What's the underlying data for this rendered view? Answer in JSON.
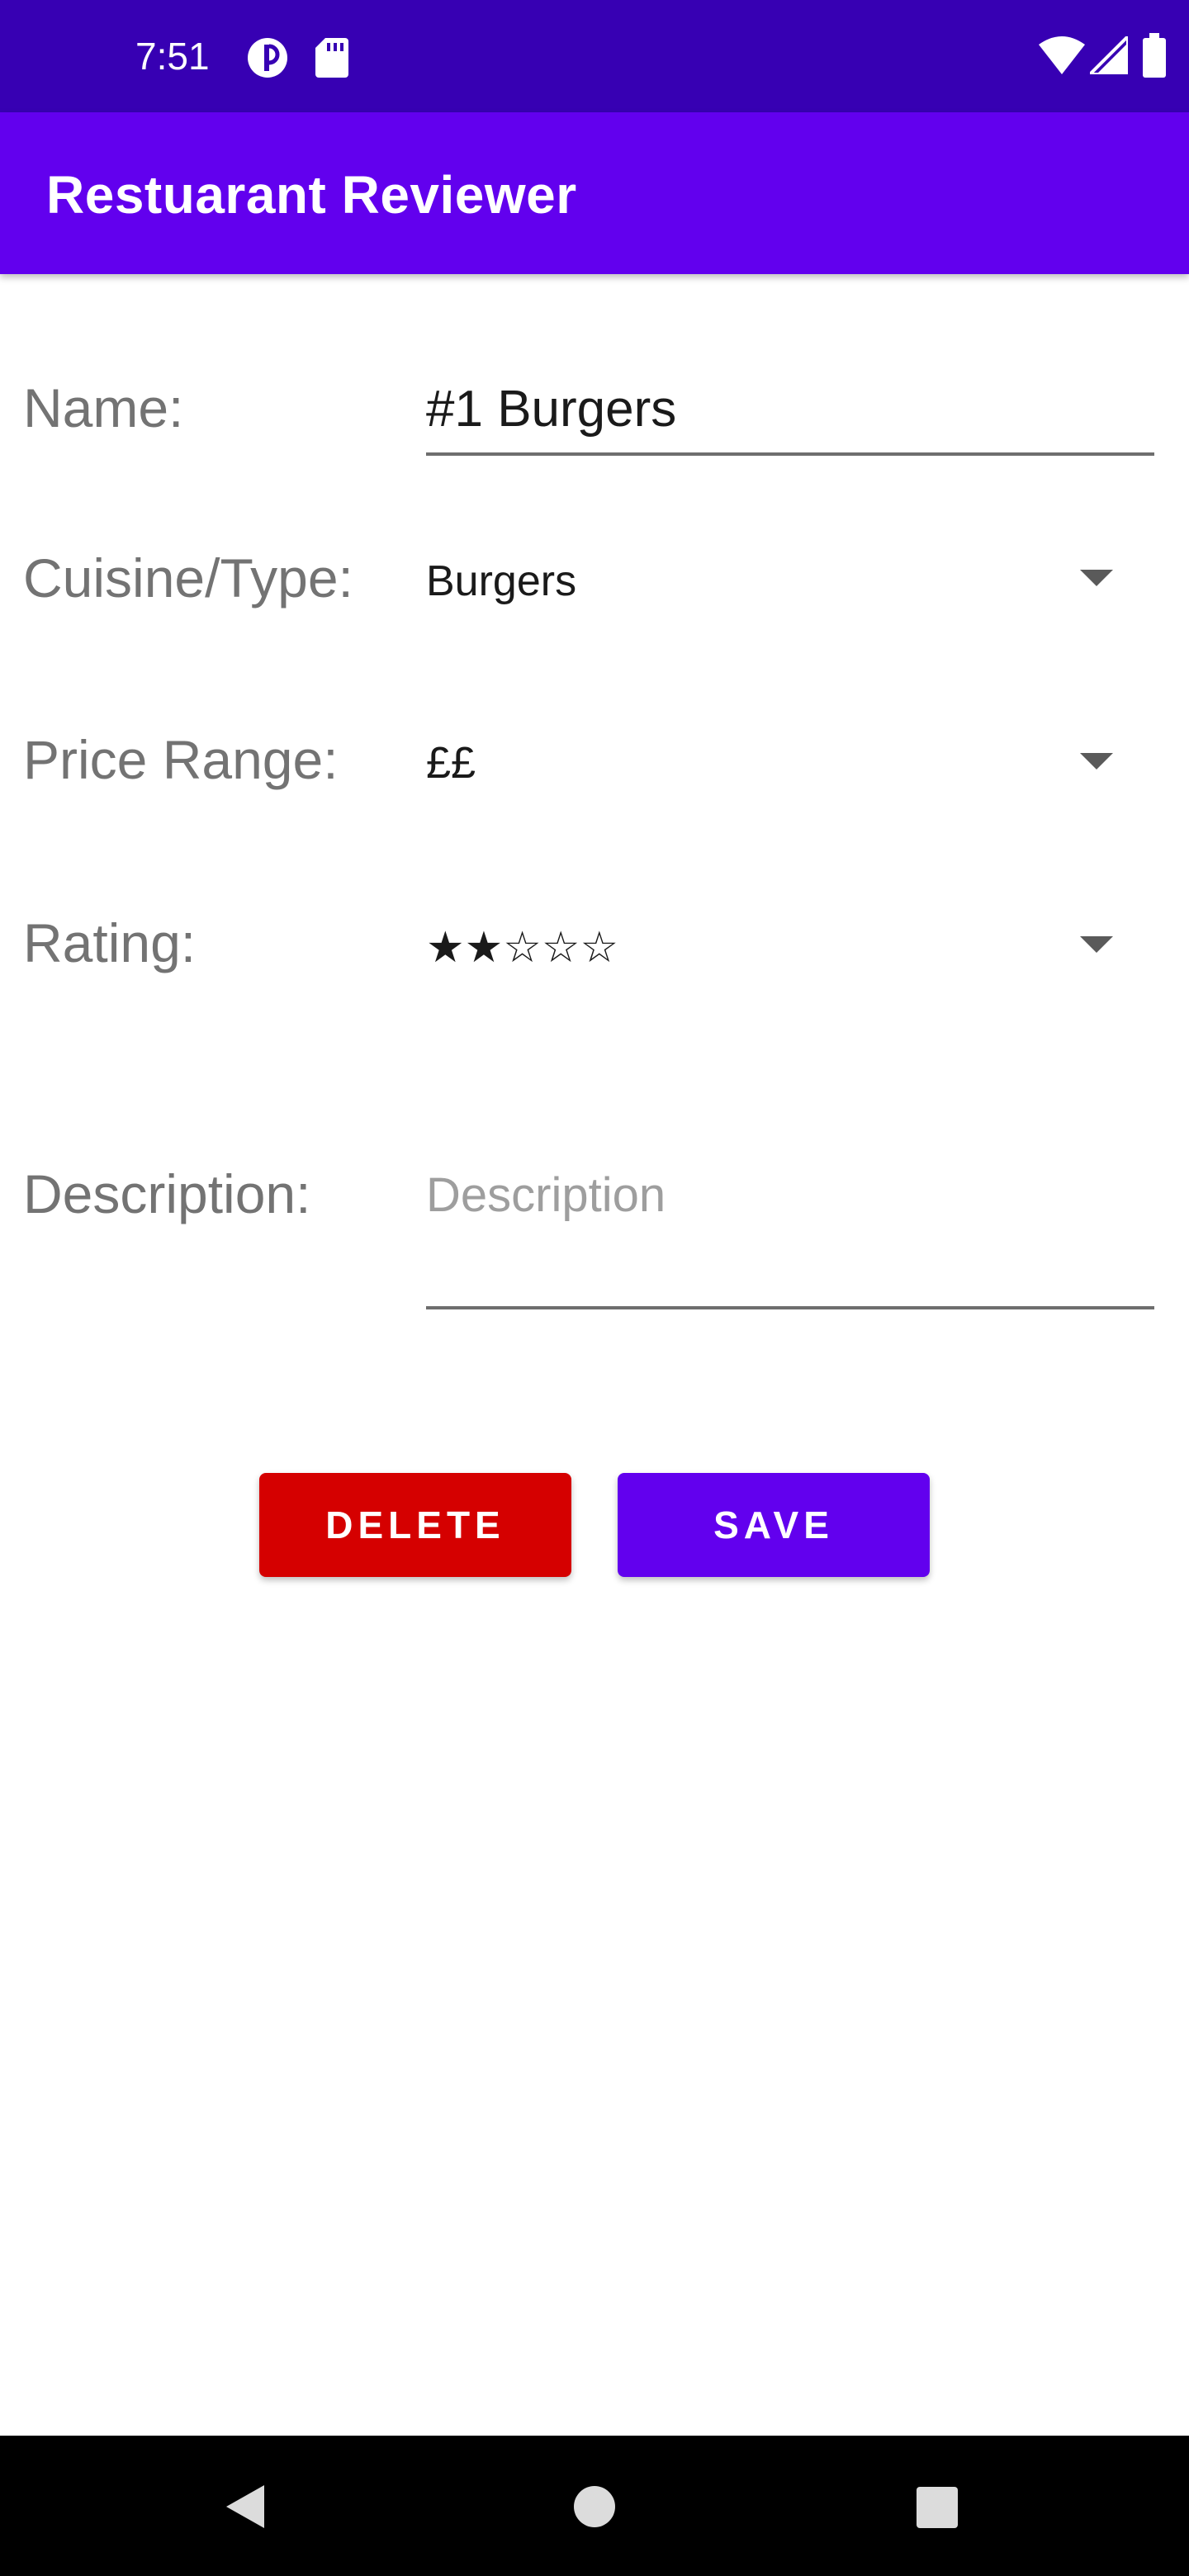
{
  "status_bar": {
    "time": "7:51",
    "icons": [
      "cloud-sync-icon",
      "sd-card-icon",
      "wifi-icon",
      "signal-icon",
      "battery-icon"
    ]
  },
  "app_bar": {
    "title": "Restuarant Reviewer"
  },
  "form": {
    "name": {
      "label": "Name:",
      "value": "#1 Burgers"
    },
    "cuisine": {
      "label": "Cuisine/Type:",
      "value": "Burgers"
    },
    "price": {
      "label": "Price Range:",
      "value": "££"
    },
    "rating": {
      "label": "Rating:",
      "value": "★★☆☆☆"
    },
    "description": {
      "label": "Description:",
      "placeholder": "Description"
    }
  },
  "buttons": {
    "delete_label": "DELETE",
    "save_label": "SAVE"
  },
  "nav_bar": {
    "icons": [
      "back-icon",
      "home-icon",
      "recents-icon"
    ]
  },
  "colors": {
    "status_bar": "#3700b3",
    "primary": "#6200ee",
    "delete": "#d50000"
  }
}
